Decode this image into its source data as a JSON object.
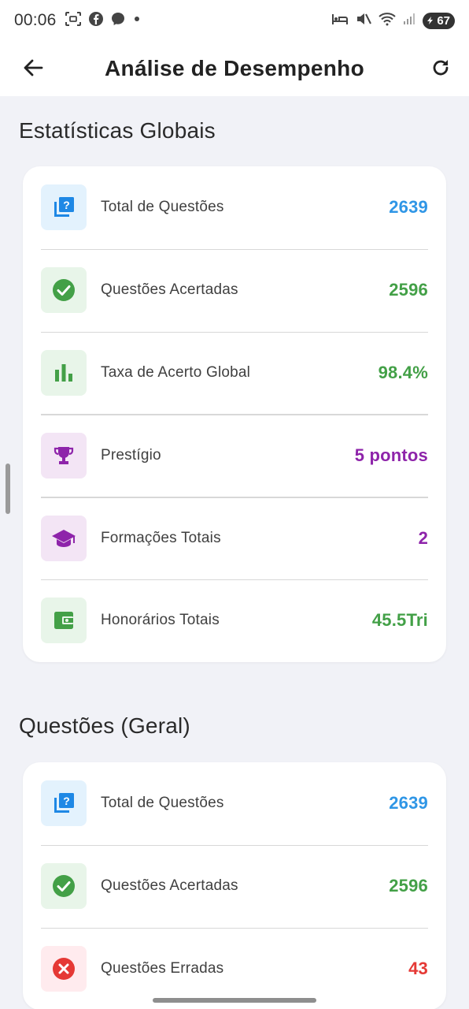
{
  "status_bar": {
    "time": "00:06",
    "battery": "67",
    "left_icons": [
      "screenshot-icon",
      "facebook-icon",
      "messenger-icon",
      "dot-icon"
    ],
    "right_icons": [
      "bed-icon",
      "mute-icon",
      "wifi-icon",
      "signal-icon",
      "battery-icon"
    ]
  },
  "app_bar": {
    "title": "Análise de Desempenho",
    "back_icon": "arrow-back-icon",
    "refresh_icon": "refresh-icon"
  },
  "sections": [
    {
      "title": "Estatísticas Globais",
      "rows": [
        {
          "label": "Total de Questões",
          "value": "2639",
          "icon": "quiz-icon",
          "value_color": "#2f96e6",
          "icon_bg": "#e3f2fd"
        },
        {
          "label": "Questões Acertadas",
          "value": "2596",
          "icon": "check-circle-icon",
          "value_color": "#43a047",
          "icon_bg": "#e8f5e9"
        },
        {
          "label": "Taxa de Acerto Global",
          "value": "98.4%",
          "icon": "bar-chart-icon",
          "value_color": "#43a047",
          "icon_bg": "#e8f5e9"
        },
        {
          "label": "Prestígio",
          "value": "5 pontos",
          "icon": "trophy-icon",
          "value_color": "#8e24aa",
          "icon_bg": "#f3e5f5"
        },
        {
          "label": "Formações Totais",
          "value": "2",
          "icon": "graduation-cap-icon",
          "value_color": "#8e24aa",
          "icon_bg": "#f3e5f5"
        },
        {
          "label": "Honorários Totais",
          "value": "45.5Tri",
          "icon": "wallet-icon",
          "value_color": "#43a047",
          "icon_bg": "#e8f5e9"
        }
      ]
    },
    {
      "title": "Questões (Geral)",
      "rows": [
        {
          "label": "Total de Questões",
          "value": "2639",
          "icon": "quiz-icon",
          "value_color": "#2f96e6",
          "icon_bg": "#e3f2fd"
        },
        {
          "label": "Questões Acertadas",
          "value": "2596",
          "icon": "check-circle-icon",
          "value_color": "#43a047",
          "icon_bg": "#e8f5e9"
        },
        {
          "label": "Questões Erradas",
          "value": "43",
          "icon": "error-circle-icon",
          "value_color": "#e53935",
          "icon_bg": "#ffebee"
        }
      ]
    }
  ]
}
